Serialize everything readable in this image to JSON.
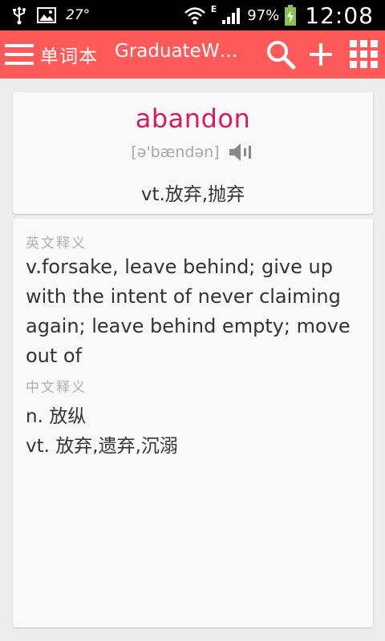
{
  "status_bar": {
    "temperature": "27°",
    "battery_percent": "97%",
    "network_type": "E",
    "time": "12:08"
  },
  "app_bar": {
    "title": "单词本",
    "subtitle": "GraduateW…",
    "icons": [
      "menu-icon",
      "search-icon",
      "add-icon",
      "grid-icon"
    ],
    "background": "#ff5a5a"
  },
  "word_card": {
    "word": "abandon",
    "phonetic": "[ə'bændən]",
    "brief_meaning": "vt.放弃,抛弃",
    "word_color": "#d81b60"
  },
  "detail_card": {
    "english_label": "英文释义",
    "english_definition": "v.forsake, leave behind; give up with the intent of never claiming again; leave behind empty; move out of",
    "chinese_label": "中文释义",
    "chinese_definitions": [
      "n. 放纵",
      "vt. 放弃,遗弃,沉溺"
    ]
  }
}
